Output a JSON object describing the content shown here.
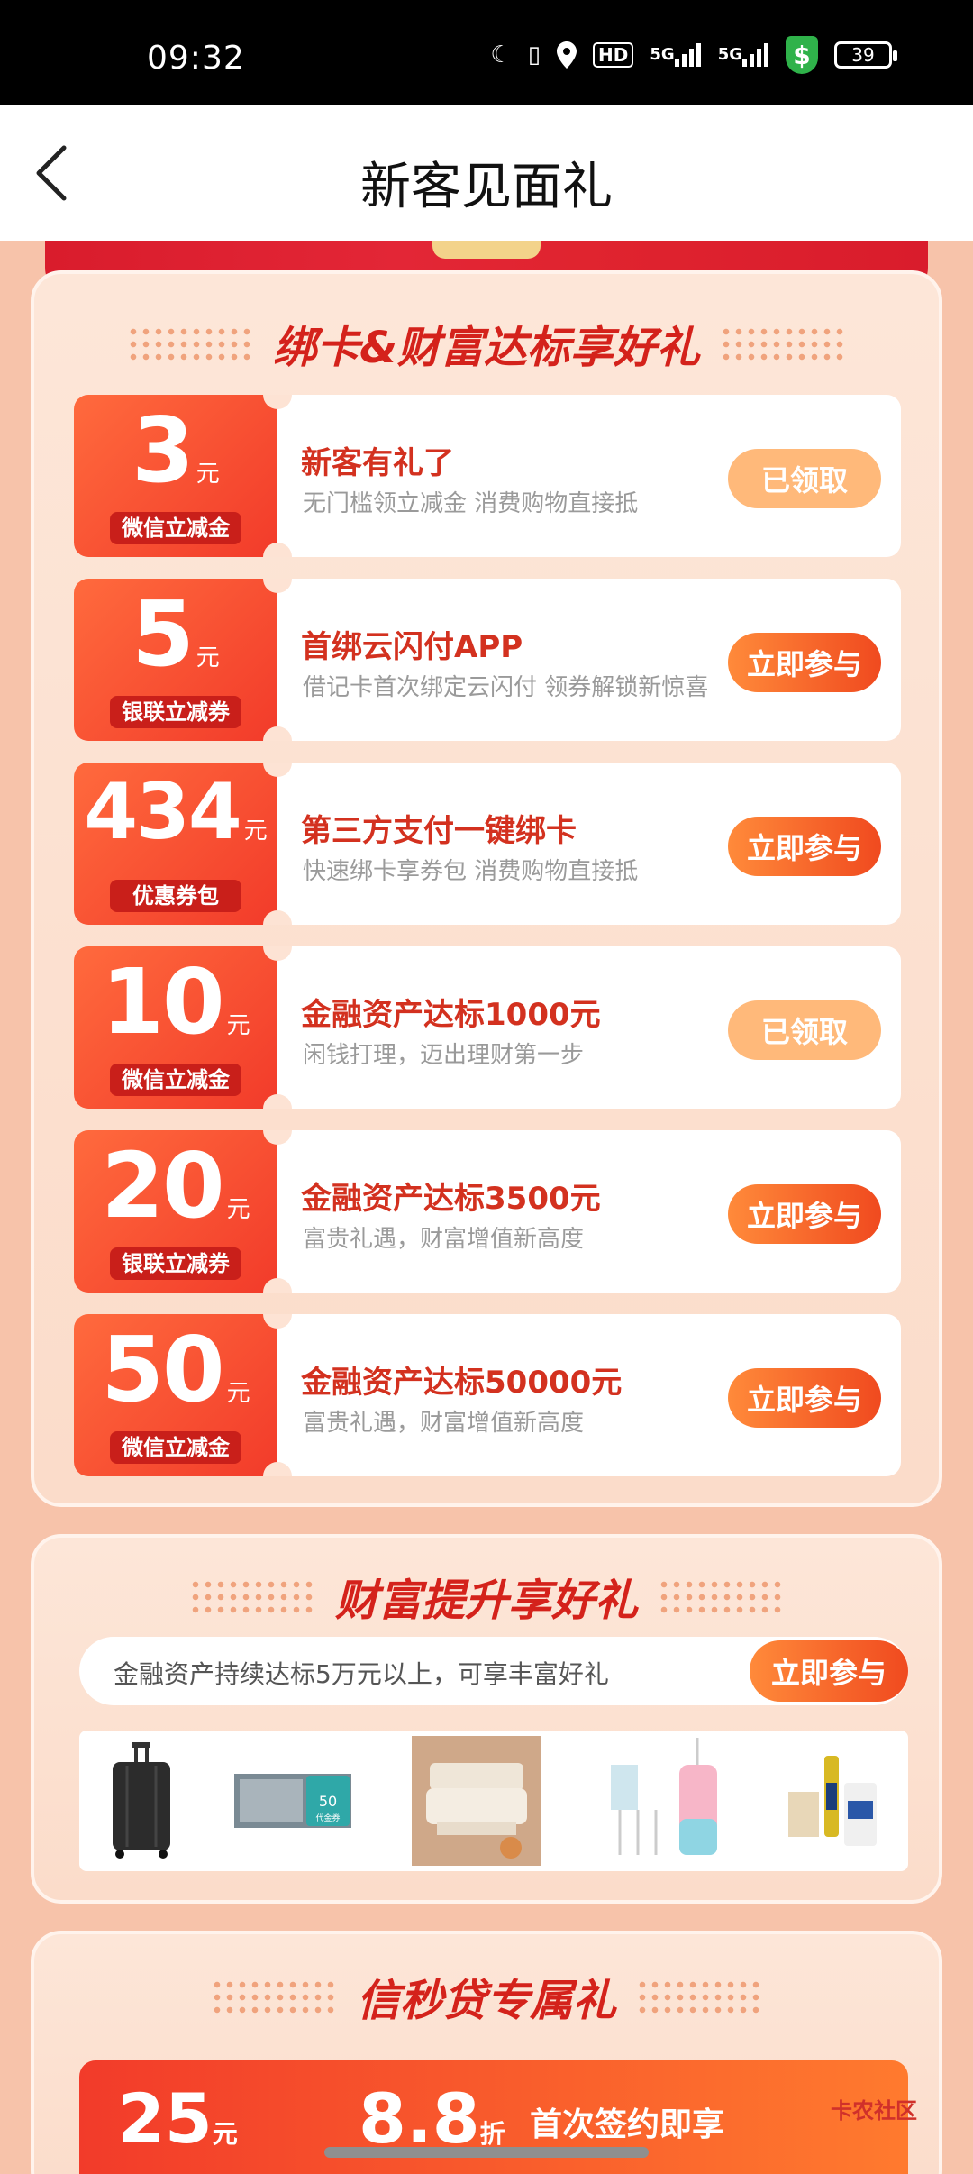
{
  "status_bar": {
    "time": "09:32",
    "battery": "39",
    "hd": "HD",
    "net1": "5G",
    "net2": "5G"
  },
  "nav": {
    "title": "新客见面礼"
  },
  "section1": {
    "title": "绑卡&财富达标享好礼",
    "cards": [
      {
        "amount": "3",
        "unit": "元",
        "tag": "微信立减金",
        "title": "新客有礼了",
        "desc": "无门槛领立减金 消费购物直接抵",
        "button": "已领取",
        "state": "done"
      },
      {
        "amount": "5",
        "unit": "元",
        "tag": "银联立减券",
        "title": "首绑云闪付APP",
        "desc": "借记卡首次绑定云闪付 领券解锁新惊喜",
        "button": "立即参与",
        "state": "active"
      },
      {
        "amount": "434",
        "unit": "元",
        "tag": "优惠券包",
        "title": "第三方支付一键绑卡",
        "desc": "快速绑卡享券包 消费购物直接抵",
        "button": "立即参与",
        "state": "active"
      },
      {
        "amount": "10",
        "unit": "元",
        "tag": "微信立减金",
        "title": "金融资产达标1000元",
        "desc": "闲钱打理，迈出理财第一步",
        "button": "已领取",
        "state": "done"
      },
      {
        "amount": "20",
        "unit": "元",
        "tag": "银联立减券",
        "title": "金融资产达标3500元",
        "desc": "富贵礼遇，财富增值新高度",
        "button": "立即参与",
        "state": "active"
      },
      {
        "amount": "50",
        "unit": "元",
        "tag": "微信立减金",
        "title": "金融资产达标50000元",
        "desc": "富贵礼遇，财富增值新高度",
        "button": "立即参与",
        "state": "active"
      }
    ]
  },
  "section2": {
    "title": "财富提升享好礼",
    "info": "金融资产持续达标5万元以上，可享丰富好礼",
    "button": "立即参与",
    "voucher_value": "50",
    "voucher_label": "代金券"
  },
  "section3": {
    "title": "信秒贷专属礼",
    "amount1": "25",
    "unit1": "元",
    "amount2": "8.8",
    "unit2": "折",
    "text": "首次签约即享"
  },
  "watermark": "卡农社区"
}
